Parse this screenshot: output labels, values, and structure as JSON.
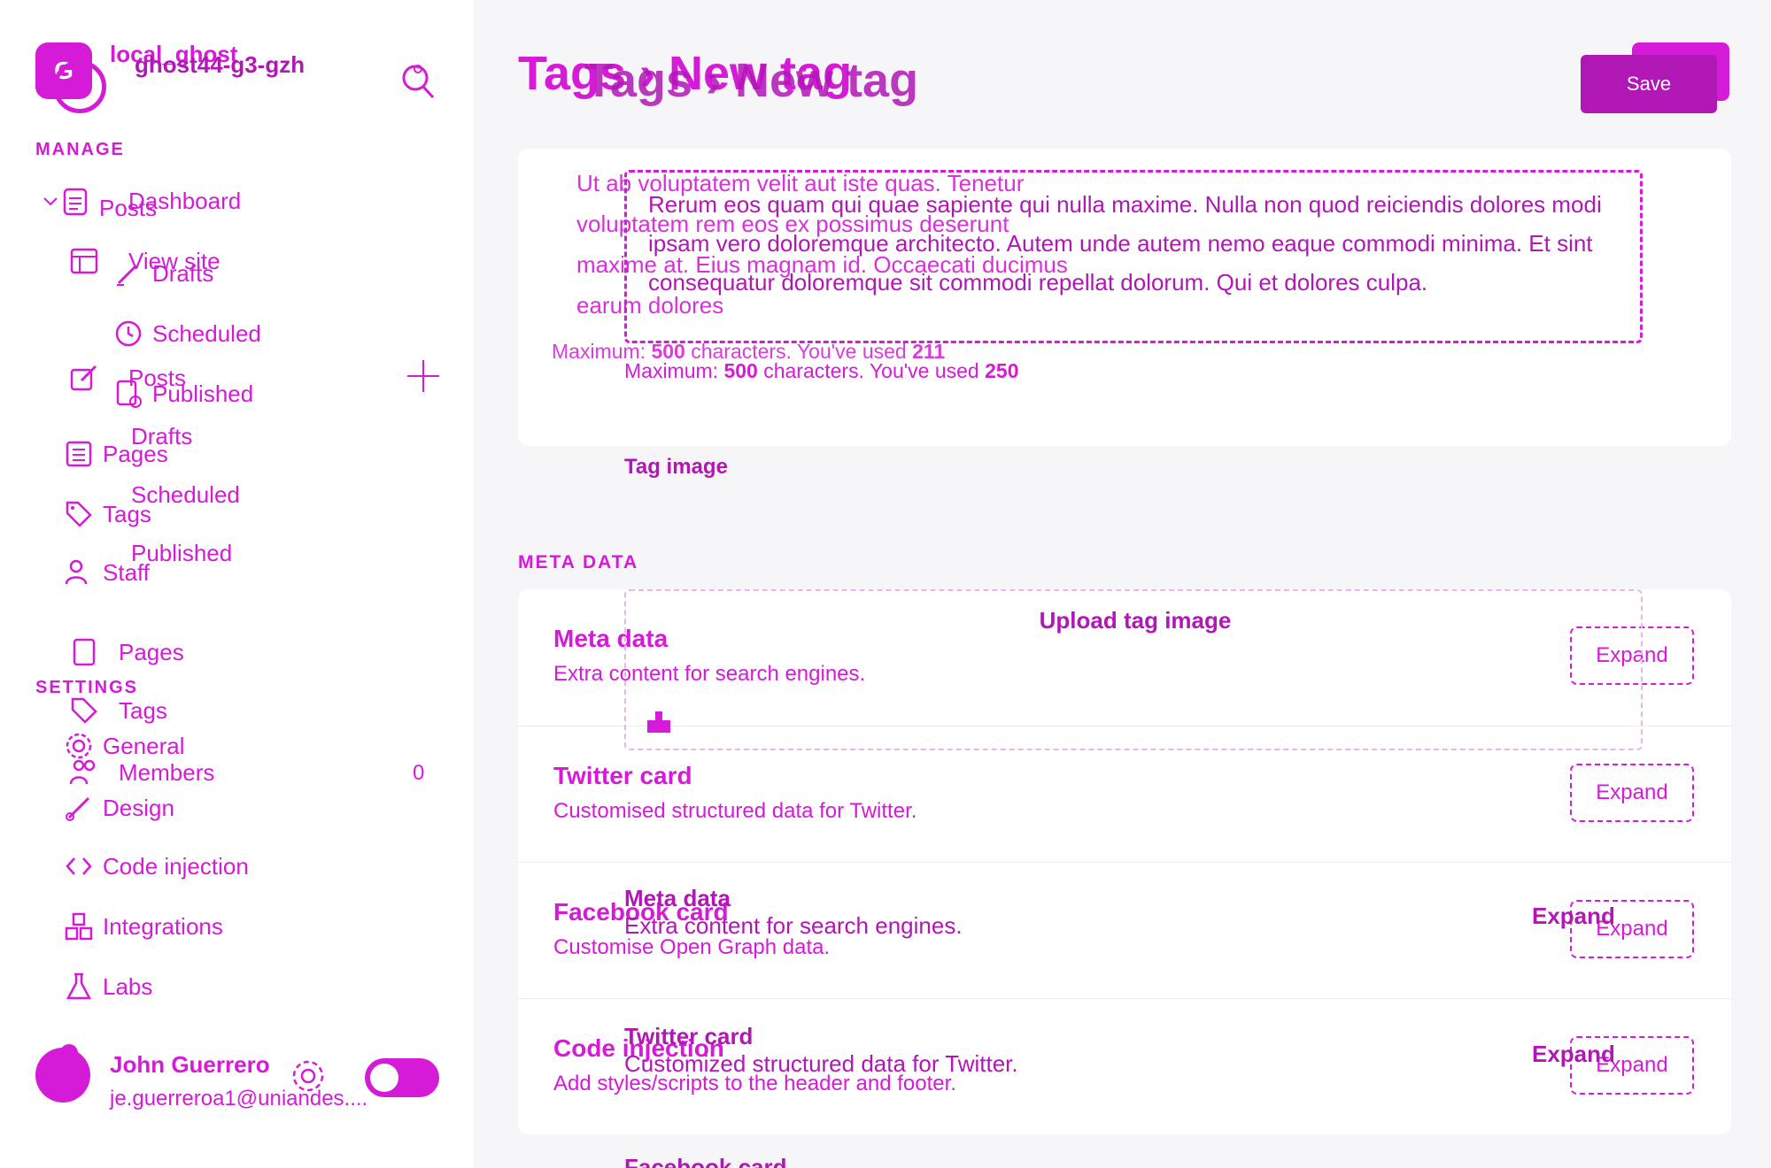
{
  "brand": {
    "name": "local_ghost",
    "site": "ghost44-g3-gzh",
    "logo_letter": "G"
  },
  "sidebar": {
    "manage_label": "MANAGE",
    "settings_label": "SETTINGS",
    "primary": {
      "dashboard": "Dashboard",
      "view_site": "View site",
      "posts": "Posts",
      "drafts": "Drafts",
      "scheduled": "Scheduled",
      "published": "Published",
      "pages": "Pages",
      "tags": "Tags",
      "members": "Members",
      "members_count": "0"
    },
    "ghost": {
      "posts": "Posts",
      "drafts": "Drafts",
      "scheduled": "Scheduled",
      "published": "Published",
      "pages": "Pages",
      "tags": "Tags",
      "staff": "Staff"
    },
    "settings": {
      "general": "General",
      "design": "Design",
      "code_injection": "Code injection",
      "integrations": "Integrations",
      "labs": "Labs"
    }
  },
  "user": {
    "name": "John Guerrero",
    "email": "je.guerreroa1@uniandes...."
  },
  "header": {
    "breadcrumb": "Tags › New tag",
    "breadcrumb_ghost": "Tags › New tag",
    "save_label": "Save"
  },
  "description": {
    "text": "Rerum eos quam qui quae sapiente qui nulla maxime. Nulla non quod reiciendis dolores modi ipsam vero doloremque architecto. Autem unde autem nemo eaque commodi minima. Et sint consequatur doloremque sit commodi repellat dolorum. Qui et dolores culpa.",
    "under_text": "Ut ab voluptatem velit aut iste quas. Tenetur voluptatem rem eos ex possimus deserunt maxime at. Eius magnam id. Occaecati ducimus earum dolores",
    "max_prefix": "Maximum: ",
    "max_value": "500",
    "max_mid": " characters. You've used ",
    "used_ghost": "211",
    "used_main": "250"
  },
  "tag_image": {
    "label": "Tag image",
    "upload_label": "Upload tag image"
  },
  "meta_section_label": "META DATA",
  "meta_rows": [
    {
      "title": "Meta data",
      "subtitle": "Extra content for search engines.",
      "button": "Expand"
    },
    {
      "title": "Twitter card",
      "subtitle": "Customised structured data for Twitter.",
      "button": "Expand"
    },
    {
      "title": "Facebook card",
      "subtitle": "Customise Open Graph data.",
      "button": "Expand"
    },
    {
      "title": "Code injection",
      "subtitle": "Add styles/scripts to the header and footer.",
      "button": "Expand"
    }
  ],
  "ghost_rows": [
    {
      "title": "Meta data",
      "subtitle": "Extra content for search engines.",
      "button": "Expand"
    },
    {
      "title": "Twitter card",
      "subtitle": "Customized structured data for Twitter.",
      "button": "Expand"
    },
    {
      "title": "Facebook card"
    }
  ],
  "colors": {
    "accent": "#d51ad8",
    "accent_dark": "#b017b5",
    "background": "#f6f6f8"
  }
}
